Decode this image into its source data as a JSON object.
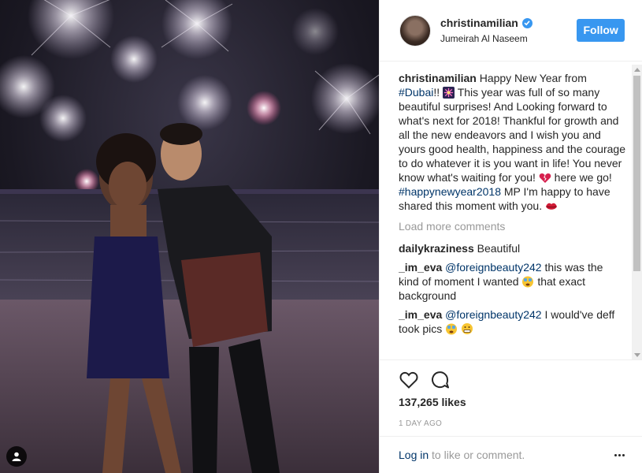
{
  "post": {
    "username": "christinamilian",
    "location": "Jumeirah Al Naseem",
    "follow_label": "Follow",
    "caption": {
      "username": "christinamilian",
      "part1": "Happy New Year from",
      "hashtag_dubai": "#Dubai",
      "part2": "!!",
      "part3": "This year was full of so many beautiful surprises! And Looking forward to what's next for 2018! Thankful for growth and all the new endeavors and I wish you and yours good health, happiness and the courage to do whatever it is you want in life! You never know what's waiting for you!",
      "part4": "here we go!",
      "hashtag_newyear": "#happynewyear2018",
      "part5": "MP I'm happy to have shared this moment with you."
    },
    "load_more_label": "Load more comments",
    "comments": [
      {
        "user": "dailykraziness",
        "text": "Beautiful"
      },
      {
        "user": "_im_eva",
        "mention": "@foreignbeauty242",
        "text": "this was the kind of moment I wanted",
        "text_after": "that exact background"
      },
      {
        "user": "_im_eva",
        "mention": "@foreignbeauty242",
        "text": "I would've deff took pics"
      }
    ],
    "likes": "137,265 likes",
    "time_ago": "1 DAY AGO",
    "login_link": "Log in",
    "login_suffix": "to like or comment."
  },
  "icons": {
    "heart": "heart-icon",
    "comment": "comment-icon",
    "more": "more-options-icon",
    "user_tag": "user-tag-icon",
    "verified": "verified-badge-icon"
  },
  "colors": {
    "accent": "#3897f0",
    "link": "#003569",
    "muted": "#999999"
  }
}
